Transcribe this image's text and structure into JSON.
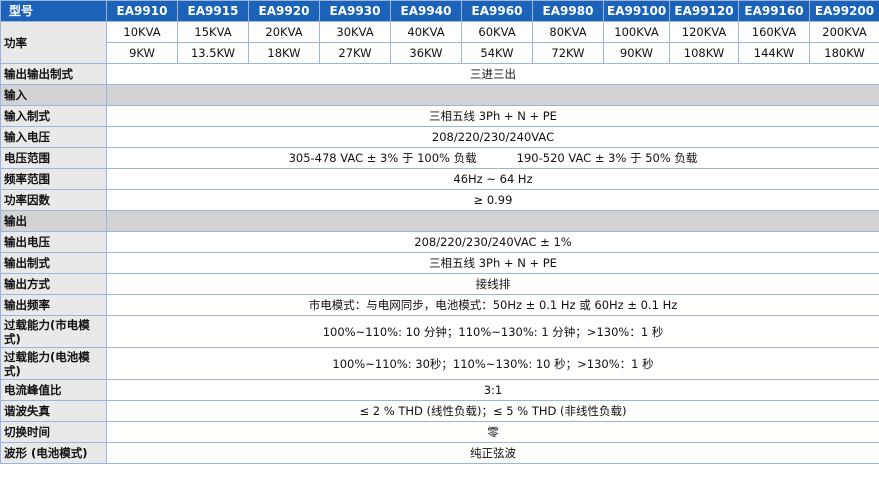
{
  "header": {
    "model_label": "型号",
    "models": [
      "EA9910",
      "EA9915",
      "EA9920",
      "EA9930",
      "EA9940",
      "EA9960",
      "EA9980",
      "EA99100",
      "EA99120",
      "EA99160",
      "EA99200"
    ]
  },
  "power": {
    "label": "功率",
    "kva": [
      "10KVA",
      "15KVA",
      "20KVA",
      "30KVA",
      "40KVA",
      "60KVA",
      "80KVA",
      "100KVA",
      "120KVA",
      "160KVA",
      "200KVA"
    ],
    "kw": [
      "9KW",
      "13.5KW",
      "18KW",
      "27KW",
      "36KW",
      "54KW",
      "72KW",
      "90KW",
      "108KW",
      "144KW",
      "180KW"
    ]
  },
  "io_system": {
    "label": "输出输出制式",
    "value": "三进三出"
  },
  "input": {
    "section": "输入",
    "rows": [
      {
        "label": "输入制式",
        "value": "三相五线 3Ph + N + PE"
      },
      {
        "label": "输入电压",
        "value": "208/220/230/240VAC"
      },
      {
        "label": "电压范围",
        "value": "305-478 VAC ± 3% 于 100% 负载",
        "value2": "190-520 VAC ± 3% 于 50% 负载"
      },
      {
        "label": "频率范围",
        "value": "46Hz ~ 64 Hz"
      },
      {
        "label": "功率因数",
        "value": "≥ 0.99"
      }
    ]
  },
  "output": {
    "section": "输出",
    "rows": [
      {
        "label": "输出电压",
        "value": "208/220/230/240VAC ± 1%"
      },
      {
        "label": "输出制式",
        "value": "三相五线 3Ph + N + PE"
      },
      {
        "label": "输出方式",
        "value": "接线排"
      },
      {
        "label": "输出频率",
        "value": "市电模式：与电网同步，电池模式：50Hz ± 0.1 Hz 或 60Hz ± 0.1 Hz"
      },
      {
        "label": "过载能力(市电模式)",
        "value": "100%~110%: 10 分钟；110%~130%: 1 分钟；>130%：1 秒",
        "tall": true
      },
      {
        "label": "过载能力(电池模式)",
        "value": "100%~110%:  30秒；110%~130%: 10 秒；>130%：1 秒",
        "tall": true
      },
      {
        "label": "电流峰值比",
        "value": "3:1"
      },
      {
        "label": "谐波失真",
        "value": "≤ 2 % THD (线性负载)；≤ 5 % THD (非线性负载)"
      },
      {
        "label": "切换时间",
        "value": "零"
      },
      {
        "label": "波形 (电池模式)",
        "value": "纯正弦波"
      }
    ]
  }
}
